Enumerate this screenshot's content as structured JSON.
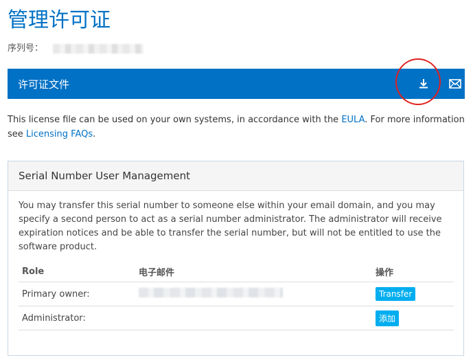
{
  "page": {
    "title": "管理许可证",
    "serial_label": "序列号："
  },
  "license_bar": {
    "title": "许可证文件",
    "download_icon": "download-icon",
    "mail_icon": "mail-icon",
    "bar_color": "#0071c5",
    "highlight_color": "#e02020"
  },
  "description": {
    "part1": "This license file can be used on your own systems, in accordance with the ",
    "eula_link": "EULA",
    "part2": ". For more information see ",
    "faq_link": "Licensing FAQs",
    "part3": "."
  },
  "panel": {
    "title": "Serial Number User Management",
    "text": "You may transfer this serial number to someone else within your email domain, and you may specify a second person to act as a serial number administrator. The administrator will receive expiration notices and be able to transfer the serial number, but will not be entitled to use the software product.",
    "columns": {
      "role": "Role",
      "email": "电子邮件",
      "action": "操作"
    },
    "rows": [
      {
        "role": "Primary owner:",
        "action": "Transfer"
      },
      {
        "role": "Administrator:",
        "action": "添加"
      }
    ],
    "button_color": "#00aeef"
  }
}
